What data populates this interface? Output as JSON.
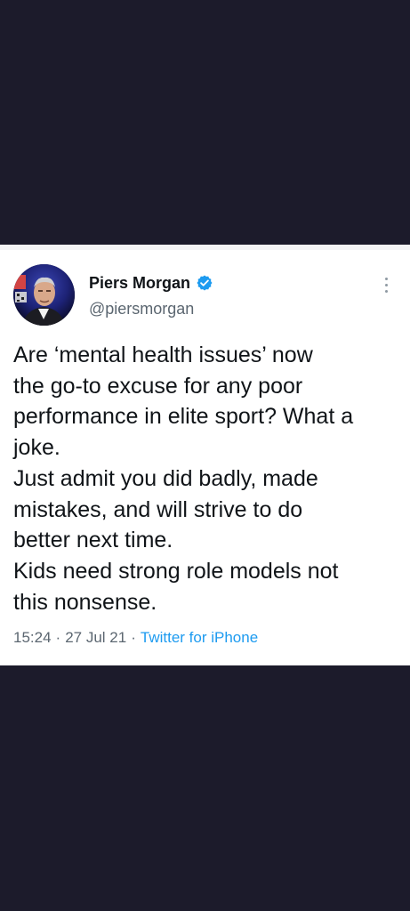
{
  "tweet": {
    "display_name": "Piers Morgan",
    "handle": "@piersmorgan",
    "verified": true,
    "text": "Are ‘mental health issues’ now\nthe go-to excuse for any poor\nperformance in elite sport? What a\njoke.\nJust admit you did badly, made\nmistakes, and will strive to do\nbetter next time.\nKids need strong role models not\nthis nonsense.",
    "time": "15:24",
    "date": "27 Jul 21",
    "source": "Twitter for iPhone",
    "separator": "·"
  },
  "icons": {
    "verified": "verified-badge-icon",
    "more": "more-options-icon"
  },
  "colors": {
    "background": "#1c1b2b",
    "card": "#ffffff",
    "text": "#101418",
    "secondary": "#5b6670",
    "link": "#1d9bf0",
    "verified": "#1d9bf0"
  }
}
